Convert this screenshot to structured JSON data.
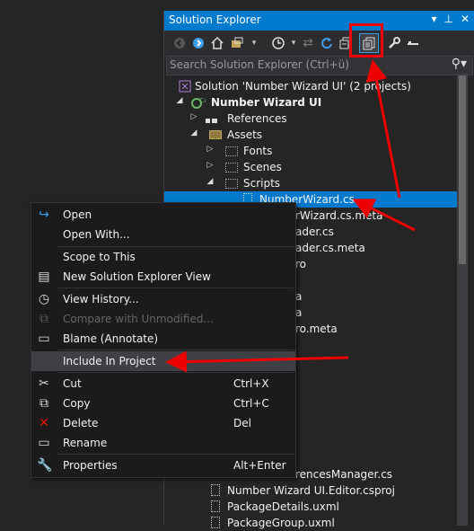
{
  "window": {
    "title": "Solution Explorer",
    "title_buttons": [
      "▾",
      "⊥",
      "✕"
    ]
  },
  "toolbar": {
    "icons": [
      "back-icon",
      "forward-icon",
      "home-icon",
      "switch-views-icon",
      "dropdown-icon",
      "pending-changes-icon",
      "dropdown-icon",
      "sync-icon",
      "refresh-icon",
      "collapse-all-icon",
      "show-all-files-icon",
      "properties-icon",
      "preview-icon"
    ]
  },
  "search": {
    "placeholder": "Search Solution Explorer (Ctrl+ü)"
  },
  "tree": {
    "solution": "Solution 'Number Wizard UI' (2 projects)",
    "project": "Number Wizard UI",
    "references": "References",
    "assets": "Assets",
    "fonts": "Fonts",
    "scenes": "Scenes",
    "scripts": "Scripts",
    "selected_file": "NumberWizard.cs",
    "partial_items": [
      "NumberWizard.cs.meta",
      "SceneLoader.cs",
      "SceneLoader.cs.meta",
      "Intro",
      "Intro.meta",
      "Lose.meta",
      "Intro.meta"
    ],
    "partial_items_visible": [
      "rWizard.cs.meta",
      "ader.cs",
      "ader.cs.meta",
      "ro",
      "a",
      "a",
      "ro.meta"
    ],
    "bottom_items": [
      "rencesManager.cs",
      "Number Wizard UI.Editor.csproj",
      "PackageDetails.uxml",
      "PackageGroup.uxml"
    ],
    "bottom_item_prefix": "PackageReferenceManager.cs"
  },
  "context_menu": {
    "items": [
      {
        "label": "Open",
        "icon": "open-icon",
        "shortcut": ""
      },
      {
        "label": "Open With...",
        "icon": "",
        "shortcut": ""
      },
      {
        "label": "Scope to This",
        "icon": "",
        "shortcut": ""
      },
      {
        "label": "New Solution Explorer View",
        "icon": "new-view-icon",
        "shortcut": ""
      },
      {
        "label": "View History...",
        "icon": "history-icon",
        "shortcut": ""
      },
      {
        "label": "Compare with Unmodified...",
        "icon": "compare-icon",
        "shortcut": "",
        "disabled": true
      },
      {
        "label": "Blame (Annotate)",
        "icon": "blame-icon",
        "shortcut": ""
      },
      {
        "label": "Include In Project",
        "icon": "",
        "shortcut": "",
        "highlighted": true
      },
      {
        "label": "Cut",
        "icon": "cut-icon",
        "shortcut": "Ctrl+X"
      },
      {
        "label": "Copy",
        "icon": "copy-icon",
        "shortcut": "Ctrl+C"
      },
      {
        "label": "Delete",
        "icon": "delete-icon",
        "shortcut": "Del"
      },
      {
        "label": "Rename",
        "icon": "rename-icon",
        "shortcut": ""
      },
      {
        "label": "Properties",
        "icon": "wrench-icon",
        "shortcut": "Alt+Enter"
      }
    ]
  },
  "colors": {
    "accent": "#007acc",
    "annotation": "#e00000",
    "background": "#252526",
    "menu": "#1b1b1c"
  }
}
